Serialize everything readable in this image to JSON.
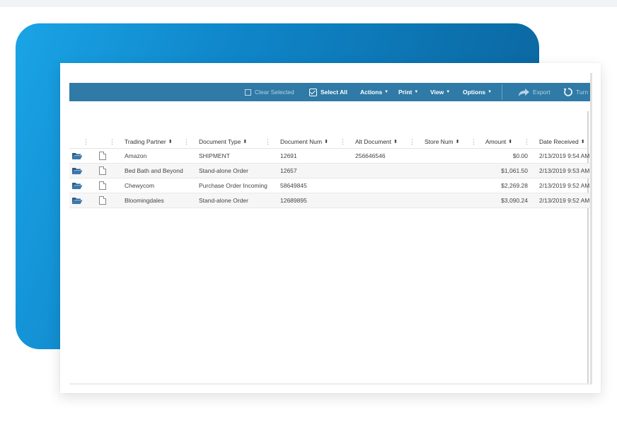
{
  "toolbar": {
    "clear_selected": "Clear Selected",
    "select_all": "Select All",
    "actions": "Actions",
    "print": "Print",
    "view": "View",
    "options": "Options",
    "export": "Export",
    "turn": "Turn"
  },
  "table": {
    "columns": [
      "Trading Partner",
      "Document Type",
      "Document Num",
      "Alt Document",
      "Store Num",
      "Amount",
      "Date Received"
    ],
    "rows": [
      {
        "partner": "Amazon",
        "type": "SHIPMENT",
        "num": "12691",
        "alt": "256646546",
        "store": "",
        "amount": "$0.00",
        "date": "2/13/2019 9:54 AM"
      },
      {
        "partner": "Bed Bath and Beyond",
        "type": "Stand-alone Order",
        "num": "12657",
        "alt": "",
        "store": "",
        "amount": "$1,061.50",
        "date": "2/13/2019 9:53 AM"
      },
      {
        "partner": "Chewycom",
        "type": "Purchase Order Incoming",
        "num": "58649845",
        "alt": "",
        "store": "",
        "amount": "$2,269.28",
        "date": "2/13/2019 9:52 AM"
      },
      {
        "partner": "Bloomingdales",
        "type": "Stand-alone Order",
        "num": "12689895",
        "alt": "",
        "store": "",
        "amount": "$3,090.24",
        "date": "2/13/2019 9:52 AM"
      }
    ]
  },
  "colors": {
    "toolbar": "#2f7aa6",
    "panel_start": "#1aa4e6",
    "panel_end": "#0a5f96",
    "row_icon": "#2a5d8c"
  },
  "icons": [
    "folder-open-icon",
    "document-icon",
    "export-arrow-icon",
    "turn-arrow-icon",
    "checkbox-icon"
  ]
}
